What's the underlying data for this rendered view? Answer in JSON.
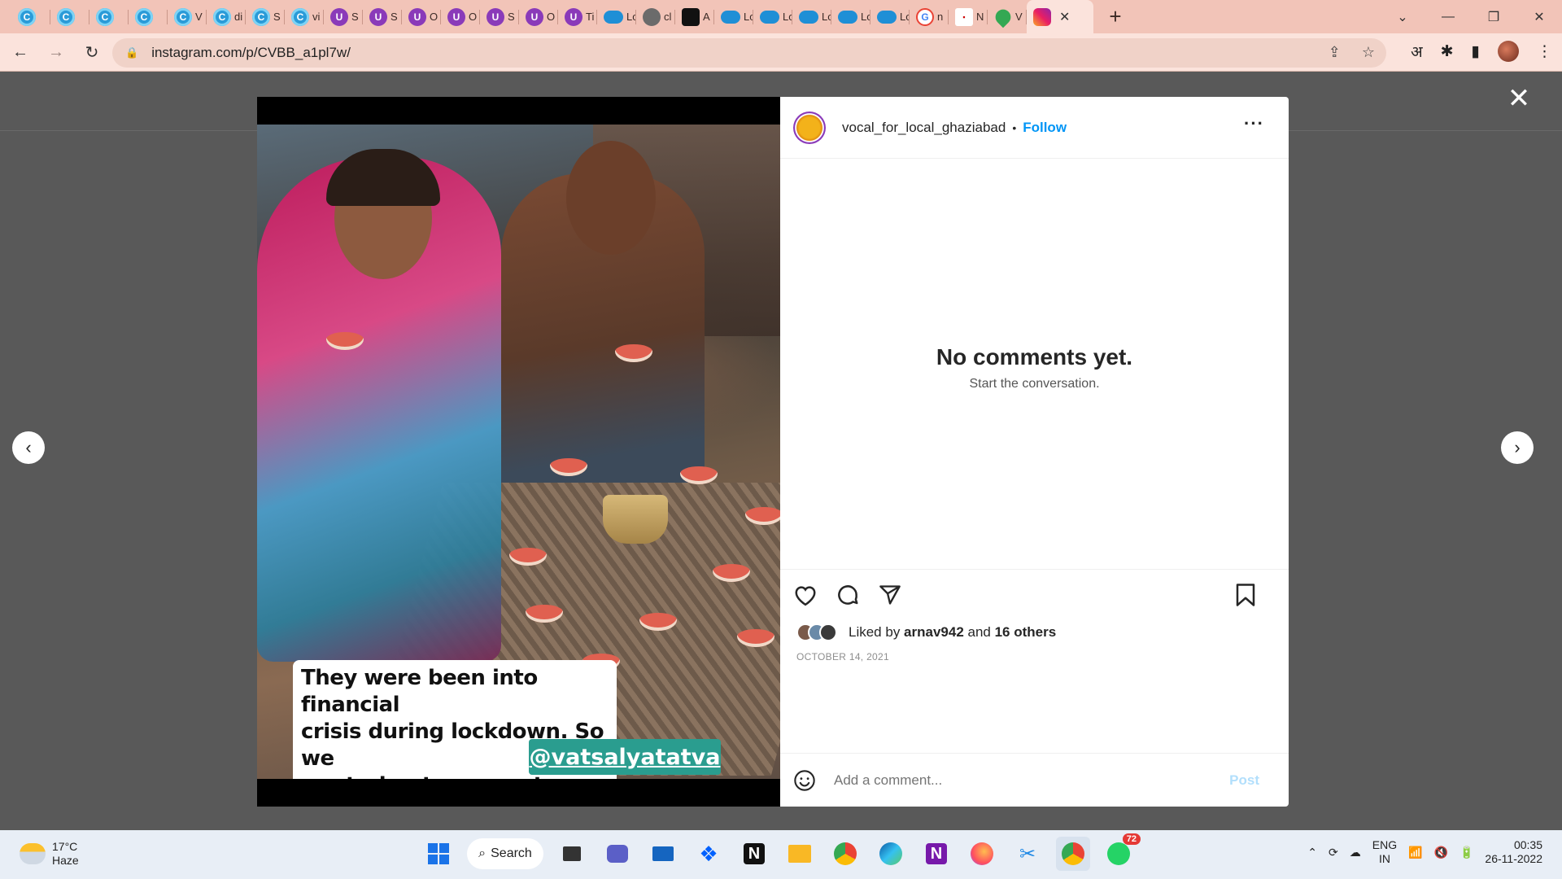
{
  "browser": {
    "tabs": [
      {
        "icon": "c-icon",
        "title": ""
      },
      {
        "icon": "c-icon",
        "title": ""
      },
      {
        "icon": "c-icon",
        "title": ""
      },
      {
        "icon": "c-icon",
        "title": ""
      },
      {
        "icon": "c-icon",
        "title": "V"
      },
      {
        "icon": "c-icon",
        "title": "di"
      },
      {
        "icon": "c-icon",
        "title": "S"
      },
      {
        "icon": "c-icon",
        "title": "vi"
      },
      {
        "icon": "u-icon",
        "title": "S"
      },
      {
        "icon": "u-icon",
        "title": "S"
      },
      {
        "icon": "u-icon",
        "title": "O"
      },
      {
        "icon": "u-icon",
        "title": "O"
      },
      {
        "icon": "u-icon",
        "title": "S"
      },
      {
        "icon": "u-icon",
        "title": "O"
      },
      {
        "icon": "u-icon",
        "title": "Ti"
      },
      {
        "icon": "cloud-icon",
        "title": "Lo"
      },
      {
        "icon": "globe-icon",
        "title": "cl"
      },
      {
        "icon": "drive-icon",
        "title": "A"
      },
      {
        "icon": "cloud-icon",
        "title": "Lo"
      },
      {
        "icon": "cloud-icon",
        "title": "Lo"
      },
      {
        "icon": "cloud-icon",
        "title": "Lo"
      },
      {
        "icon": "cloud-icon",
        "title": "Lo"
      },
      {
        "icon": "cloud-icon",
        "title": "Lo"
      },
      {
        "icon": "google-icon",
        "title": "n"
      },
      {
        "icon": "news-icon",
        "title": "N"
      },
      {
        "icon": "maps-icon",
        "title": "V"
      }
    ],
    "active_tab_icon": "instagram-icon",
    "new_tab": "+",
    "url": "instagram.com/p/CVBB_a1pl7w/",
    "lang_button": "अ"
  },
  "post": {
    "caption_lines": [
      "They were been into financial",
      "crisis during lockdown. So we",
      "are trying to support them."
    ],
    "handle": "@vatsalyatatva",
    "username": "vocal_for_local_ghaziabad",
    "separator": "•",
    "follow": "Follow",
    "more": "···",
    "no_comments": "No comments yet.",
    "start_conversation": "Start the conversation.",
    "liked_by_prefix": "Liked by ",
    "liked_by_user": "arnav942",
    "liked_by_and": " and ",
    "liked_by_others": "16 others",
    "date": "OCTOBER 14, 2021",
    "comment_placeholder": "Add a comment...",
    "post_button": "Post"
  },
  "taskbar": {
    "temp": "17°C",
    "weather": "Haze",
    "search": "Search",
    "whatsapp_badge": "72",
    "lang_top": "ENG",
    "lang_bottom": "IN",
    "time": "00:35",
    "date": "26-11-2022"
  },
  "colors": {
    "accent": "#0095f6",
    "tab_strip": "#f2c4b8",
    "toolbar": "#fbe3dc",
    "overlay": "#595959"
  }
}
